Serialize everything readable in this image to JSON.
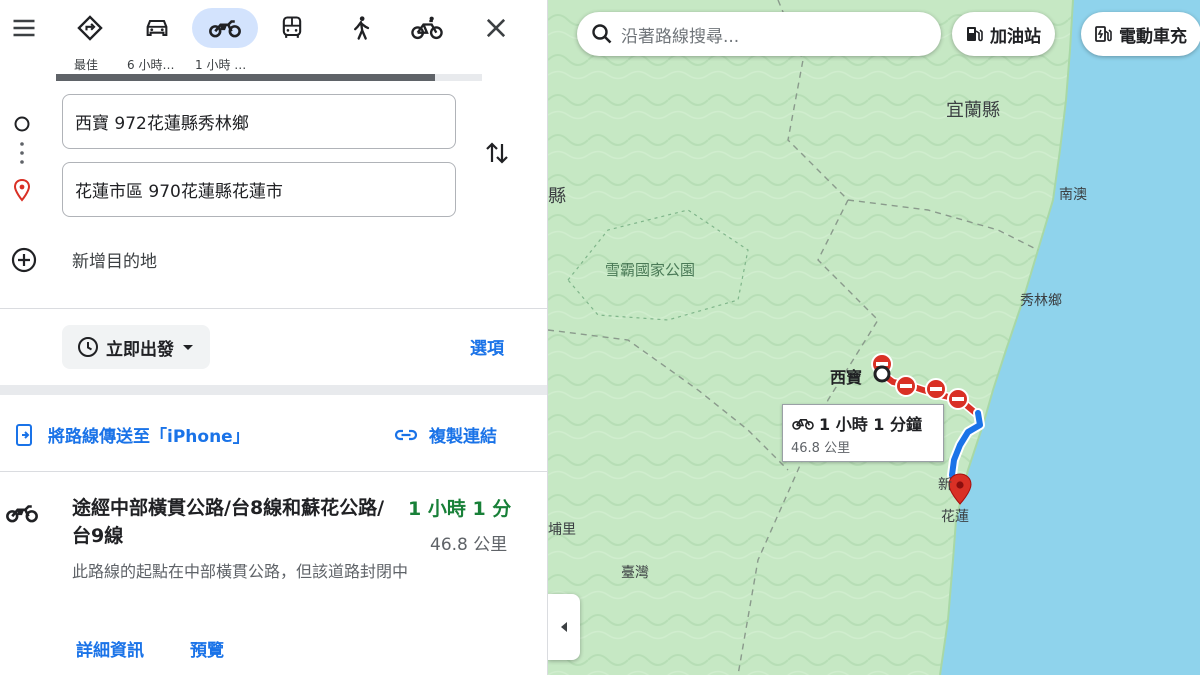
{
  "modes": {
    "best_sub": "最佳",
    "car_sub": "6 小時…",
    "moto_sub": "1 小時 …",
    "progress": 0.89
  },
  "waypoints": {
    "origin": "西寶 972花蓮縣秀林鄉",
    "destination": "花蓮市區 970花蓮縣花蓮市",
    "add_destination": "新增目的地"
  },
  "departure": {
    "label": "立即出發",
    "options": "選項"
  },
  "share": {
    "send_to_phone": "將路線傳送至「iPhone」",
    "copy_link": "複製連結"
  },
  "route": {
    "title": "途經中部橫貫公路/台8線和蘇花公路/台9線",
    "duration": "1 小時 1 分",
    "distance": "46.8 公里",
    "note": "此路線的起點在中部橫貫公路，但該道路封閉中",
    "details": "詳細資訊",
    "preview": "預覽"
  },
  "map": {
    "search_placeholder": "沿著路線搜尋...",
    "chip_gas": "加油站",
    "chip_ev": "電動車充",
    "labels": {
      "yilan": "宜蘭縣",
      "nanao": "南澳",
      "xiulin": "秀林鄉",
      "shei_pa": "雪霸國家公園",
      "xibao": "西寶",
      "county_left": "縣",
      "puli": "埔里",
      "taiwan": "臺灣",
      "hualien": "花蓮",
      "xin": "新"
    },
    "callout": {
      "duration": "1 小時 1 分鐘",
      "distance": "46.8 公里"
    },
    "colors": {
      "route": "#1a73e8",
      "closure": "#d93025",
      "sea": "#8fd3ec",
      "land": "#c6e8c4"
    }
  }
}
